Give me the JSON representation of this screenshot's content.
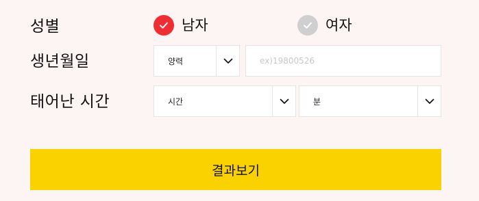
{
  "form": {
    "gender": {
      "label": "성별",
      "options": [
        {
          "label": "남자",
          "selected": true
        },
        {
          "label": "여자",
          "selected": false
        }
      ]
    },
    "birthdate": {
      "label": "생년월일",
      "calendar_select": "양력",
      "date_placeholder": "ex)19800526",
      "date_value": ""
    },
    "birthtime": {
      "label": "태어난 시간",
      "hour_select": "시간",
      "minute_select": "분"
    },
    "submit_label": "결과보기"
  },
  "colors": {
    "background": "#fdf5f3",
    "selected_radio": "#ef2d32",
    "unselected_radio": "#cfcfcf",
    "submit_button": "#fad200"
  },
  "icons": {
    "radio": "check-icon",
    "dropdown": "chevron-down-icon"
  }
}
